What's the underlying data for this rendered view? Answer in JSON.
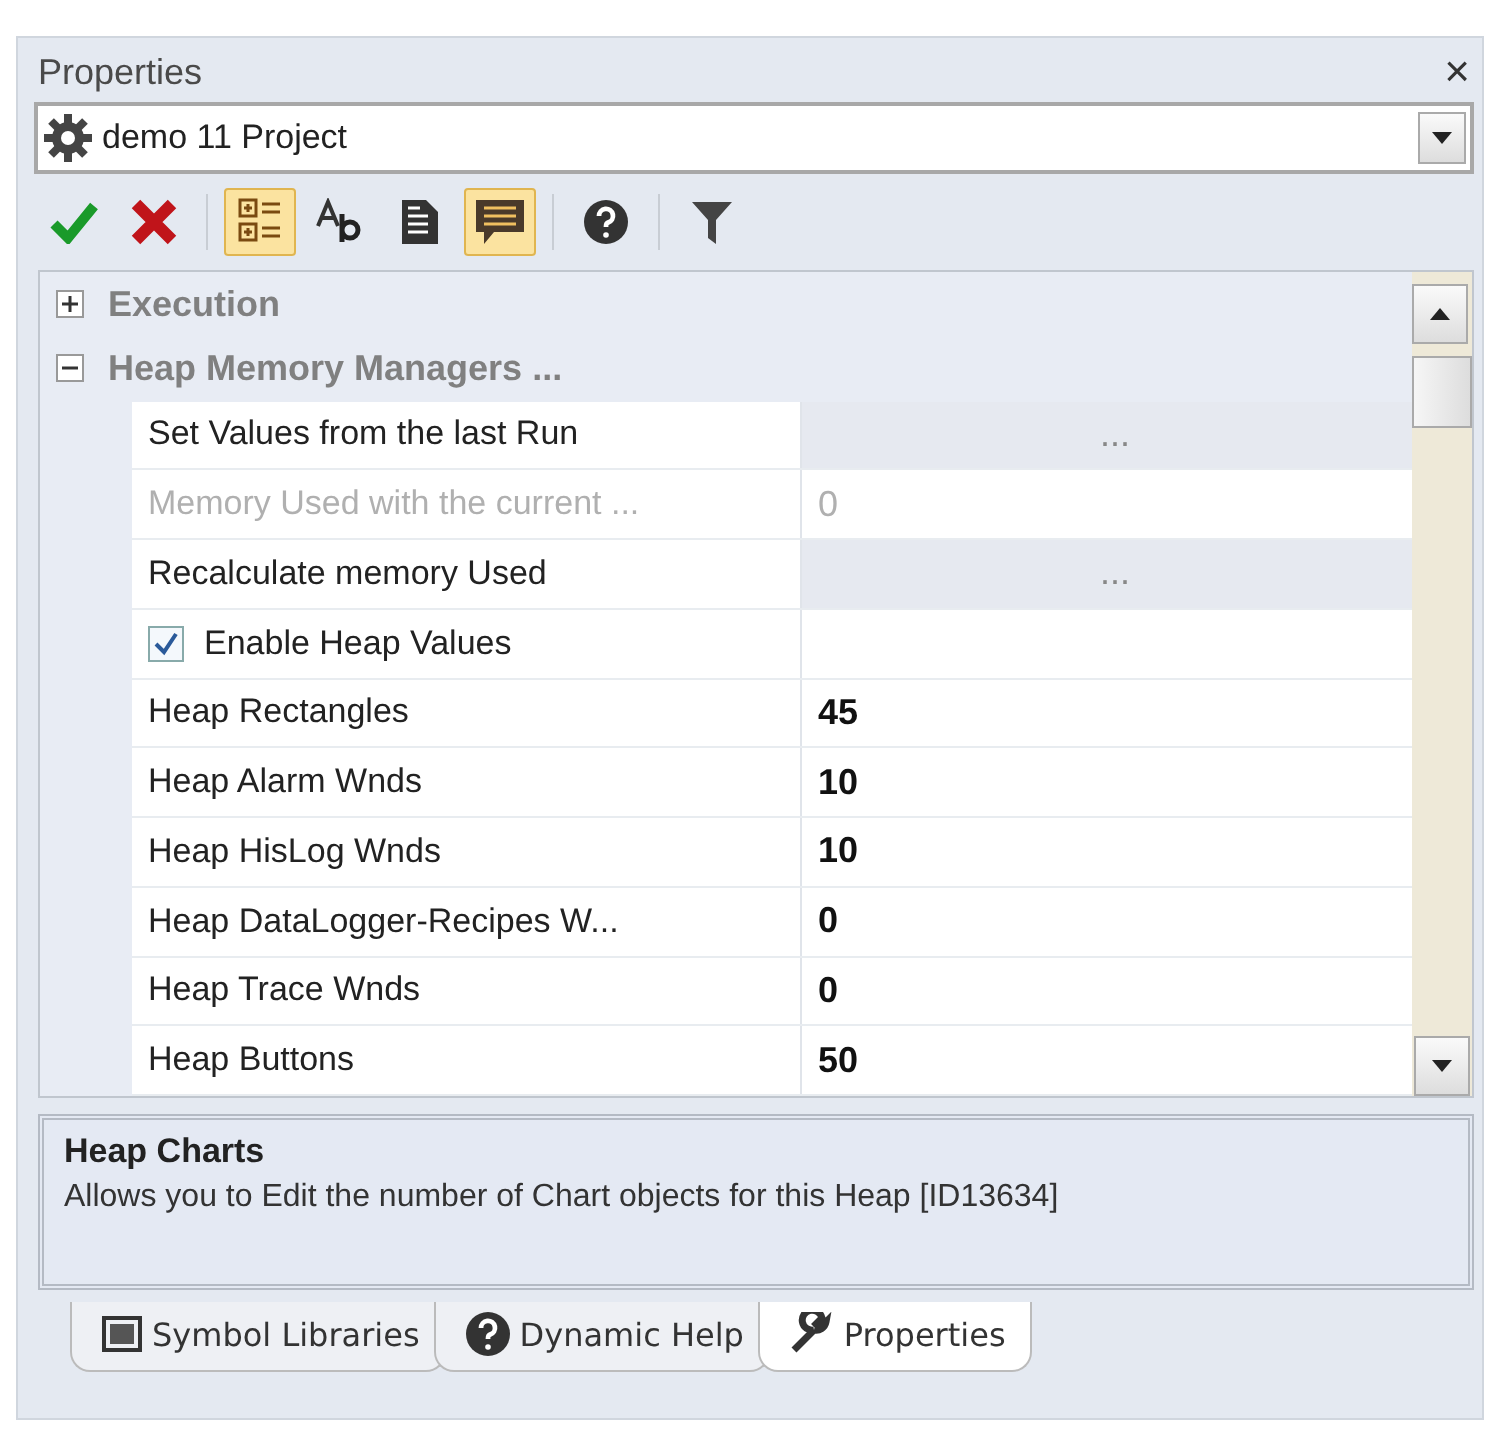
{
  "panel": {
    "title": "Properties",
    "close": "×"
  },
  "object_selector": {
    "value": "demo 11 Project"
  },
  "toolbar": [
    [
      {
        "kind": "apply",
        "selected": false
      },
      {
        "kind": "cancel",
        "selected": false
      }
    ],
    [
      {
        "kind": "categorized",
        "selected": true
      },
      {
        "kind": "alphabetic",
        "selected": false
      },
      {
        "kind": "pages",
        "selected": false
      },
      {
        "kind": "comments",
        "selected": true
      }
    ],
    [
      {
        "kind": "help",
        "selected": false
      }
    ],
    [
      {
        "kind": "filter",
        "selected": false
      }
    ]
  ],
  "grid": {
    "categories": [
      {
        "name": "Execution",
        "expanded": false
      },
      {
        "name": "Heap Memory Managers ...",
        "expanded": true,
        "rows": [
          {
            "kind": "button",
            "label": "Set Values from the last Run",
            "value": "..."
          },
          {
            "kind": "readonly",
            "label": "Memory Used with the current ...",
            "value": "0"
          },
          {
            "kind": "button",
            "label": "Recalculate memory Used",
            "value": "..."
          },
          {
            "kind": "checkbox",
            "label": "Enable Heap Values",
            "checked": true
          },
          {
            "kind": "number",
            "label": "Heap Rectangles",
            "value": "45"
          },
          {
            "kind": "number",
            "label": "Heap Alarm Wnds",
            "value": "10"
          },
          {
            "kind": "number",
            "label": "Heap HisLog Wnds",
            "value": "10"
          },
          {
            "kind": "number",
            "label": "Heap DataLogger-Recipes W...",
            "value": "0"
          },
          {
            "kind": "number",
            "label": "Heap Trace Wnds",
            "value": "0"
          },
          {
            "kind": "number",
            "label": "Heap Buttons",
            "value": "50"
          }
        ]
      }
    ]
  },
  "help": {
    "title": "Heap Charts",
    "text": "Allows you to Edit the number of Chart objects for this Heap [ID13634]"
  },
  "tabs": [
    {
      "kind": "library",
      "label": "Symbol Libraries",
      "selected": false
    },
    {
      "kind": "help",
      "label": "Dynamic Help",
      "selected": false
    },
    {
      "kind": "wrench",
      "label": "Properties",
      "selected": true
    }
  ]
}
